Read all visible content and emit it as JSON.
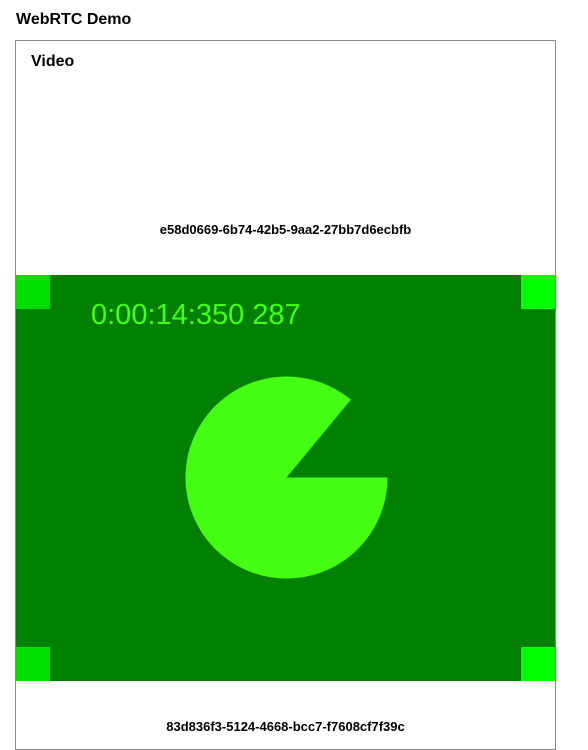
{
  "page": {
    "title": "WebRTC Demo"
  },
  "panel": {
    "heading": "Video",
    "local_stream_id": "e58d0669-6b74-42b5-9aa2-27bb7d6ecbfb",
    "remote_stream_id": "83d836f3-5124-4668-bcc7-f7608cf7f39c"
  },
  "video": {
    "timestamp": "0:00:14:350 287",
    "background_color": "#008000",
    "marker_color": "#00ff00",
    "marker_color_dim": "#00e000",
    "foreground_color": "#44ff11",
    "pie_missing_fraction": 0.14
  }
}
